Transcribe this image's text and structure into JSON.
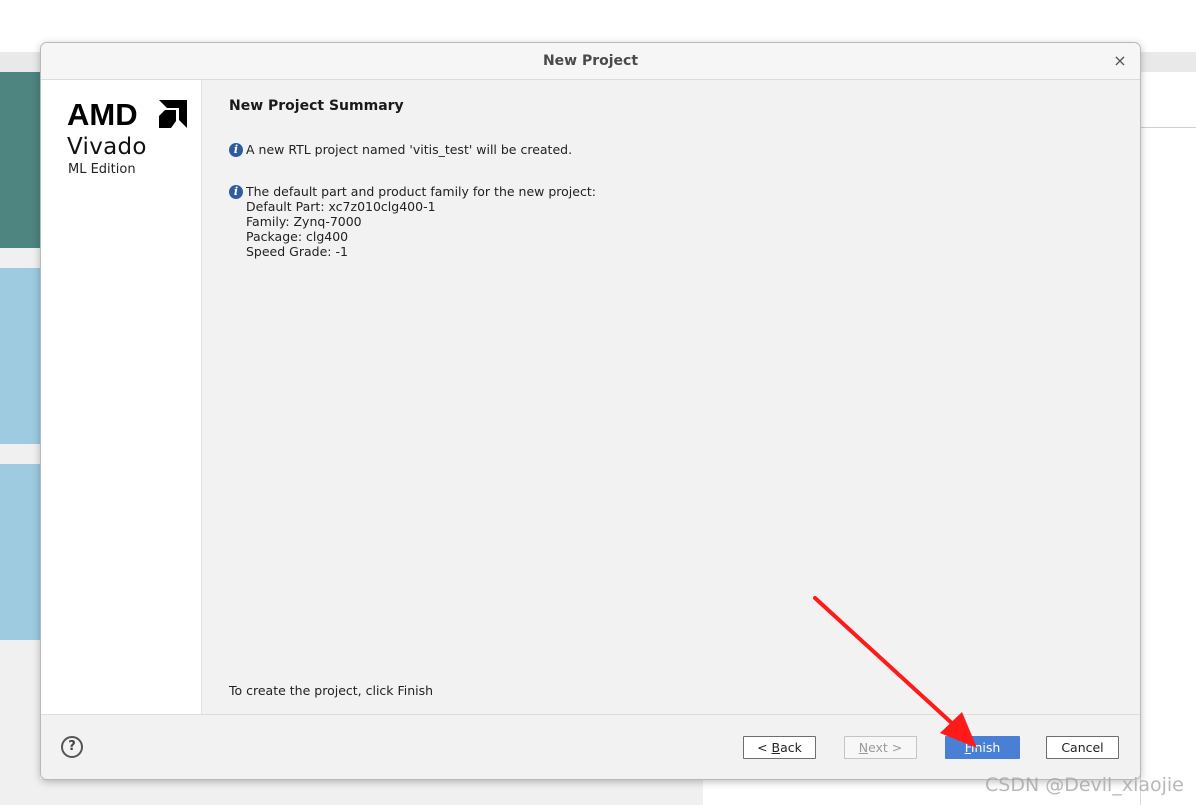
{
  "dialog": {
    "title": "New Project",
    "close_symbol": "×",
    "logo": {
      "brand": "AMD",
      "product": "Vivado",
      "edition": "ML Edition"
    },
    "heading": "New Project Summary",
    "info1": "A new RTL project named 'vitis_test' will be created.",
    "info2": {
      "text": "The default part and product family for the new project:",
      "default_part": "Default Part: xc7z010clg400-1",
      "family": "Family: Zynq-7000",
      "package": "Package: clg400",
      "speed_grade": "Speed Grade: -1"
    },
    "footer_note": "To create the project, click Finish",
    "buttons": {
      "help": "?",
      "back_prefix": "< ",
      "back_mnemonic": "B",
      "back_rest": "ack",
      "next_mnemonic": "N",
      "next_rest": "ext >",
      "finish_mnemonic": "F",
      "finish_rest": "inish",
      "cancel": "Cancel"
    },
    "colors": {
      "finish_button": "#4a7fd6",
      "info_icon": "#2f5d9c",
      "annotation_arrow": "#ff1a1a"
    }
  },
  "watermark": "CSDN @Devil_xiaojie"
}
